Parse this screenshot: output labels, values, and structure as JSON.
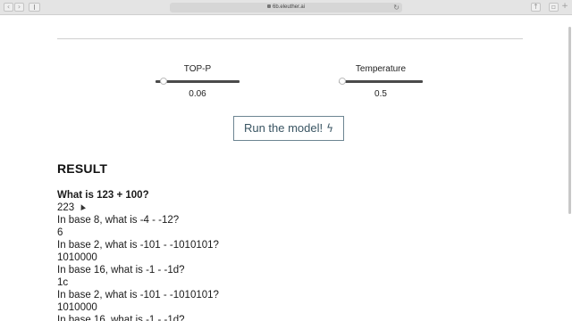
{
  "browser": {
    "url": "6b.eleuther.ai"
  },
  "controls": {
    "top_p": {
      "label": "TOP-P",
      "value": "0.06",
      "fraction": 0.06
    },
    "temperature": {
      "label": "Temperature",
      "value": "0.5",
      "fraction": 0.0
    },
    "run_button_label": "Run the model!"
  },
  "result": {
    "title": "RESULT",
    "prompt": "What is 123 + 100?",
    "lines": [
      "223",
      "In base 8, what is -4 - -12?",
      "6",
      "In base 2, what is -101 - -1010101?",
      "1010000",
      "In base 16, what is -1 - -1d?",
      "1c",
      "In base 2, what is -101 - -1010101?",
      "1010000",
      "In base 16, what is -1 - -1d?"
    ]
  }
}
